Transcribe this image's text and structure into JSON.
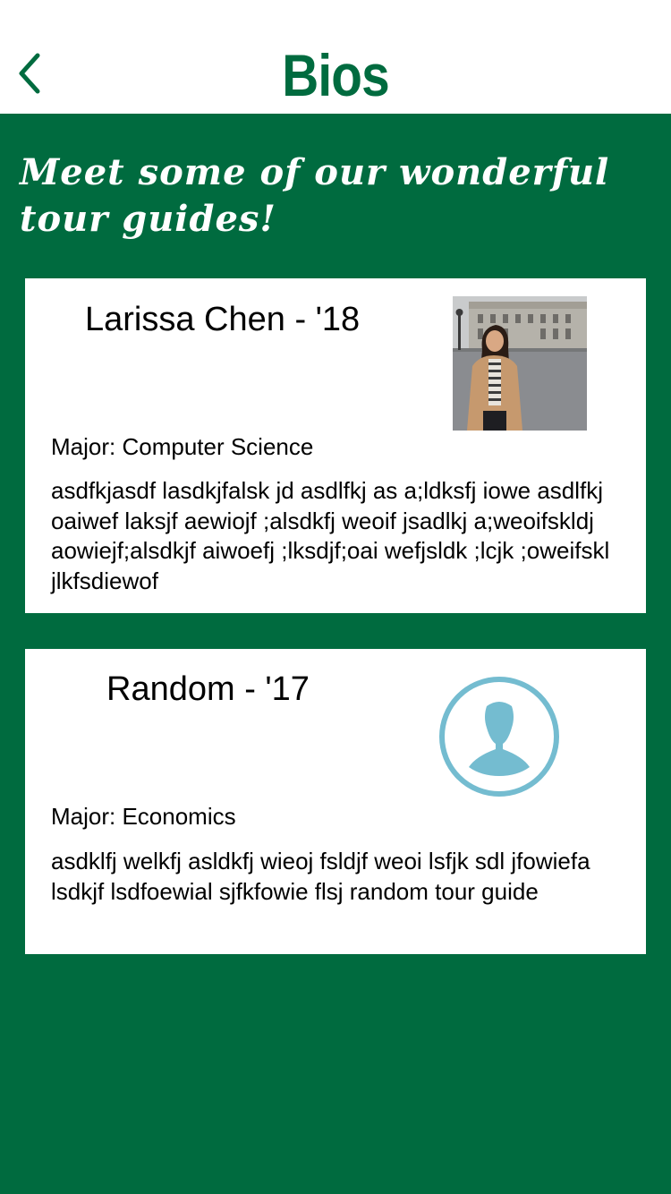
{
  "header": {
    "title": "Bios",
    "back_icon": "chevron-left-icon",
    "accent_color": "#006b3f"
  },
  "intro_text": "Meet some of our wonderful tour guides!",
  "guides": [
    {
      "name": "Larissa Chen - '18",
      "major": "Major: Computer Science",
      "bio": "asdfkjasdf lasdkjfalsk jd asdlfkj as a;ldksfj iowe asdlfkj oaiwef laksjf aewiojf ;alsdkfj weoif jsadlkj a;weoifskldj aowiejf;alsdkjf aiwoefj ;lksdjf;oai wefjsldk ;lcjk ;oweifskl jlkfsdiewof",
      "image": "guide-photo"
    },
    {
      "name": "Random - '17",
      "major": "Major: Economics",
      "bio": "asdklfj welkfj asldkfj wieoj fsldjf weoi lsfjk sdl jfowiefa lsdkjf lsdfoewial sjfkfowie flsj random tour guide",
      "image": "default-user-avatar-icon",
      "avatar_color": "#74bcd0"
    }
  ]
}
